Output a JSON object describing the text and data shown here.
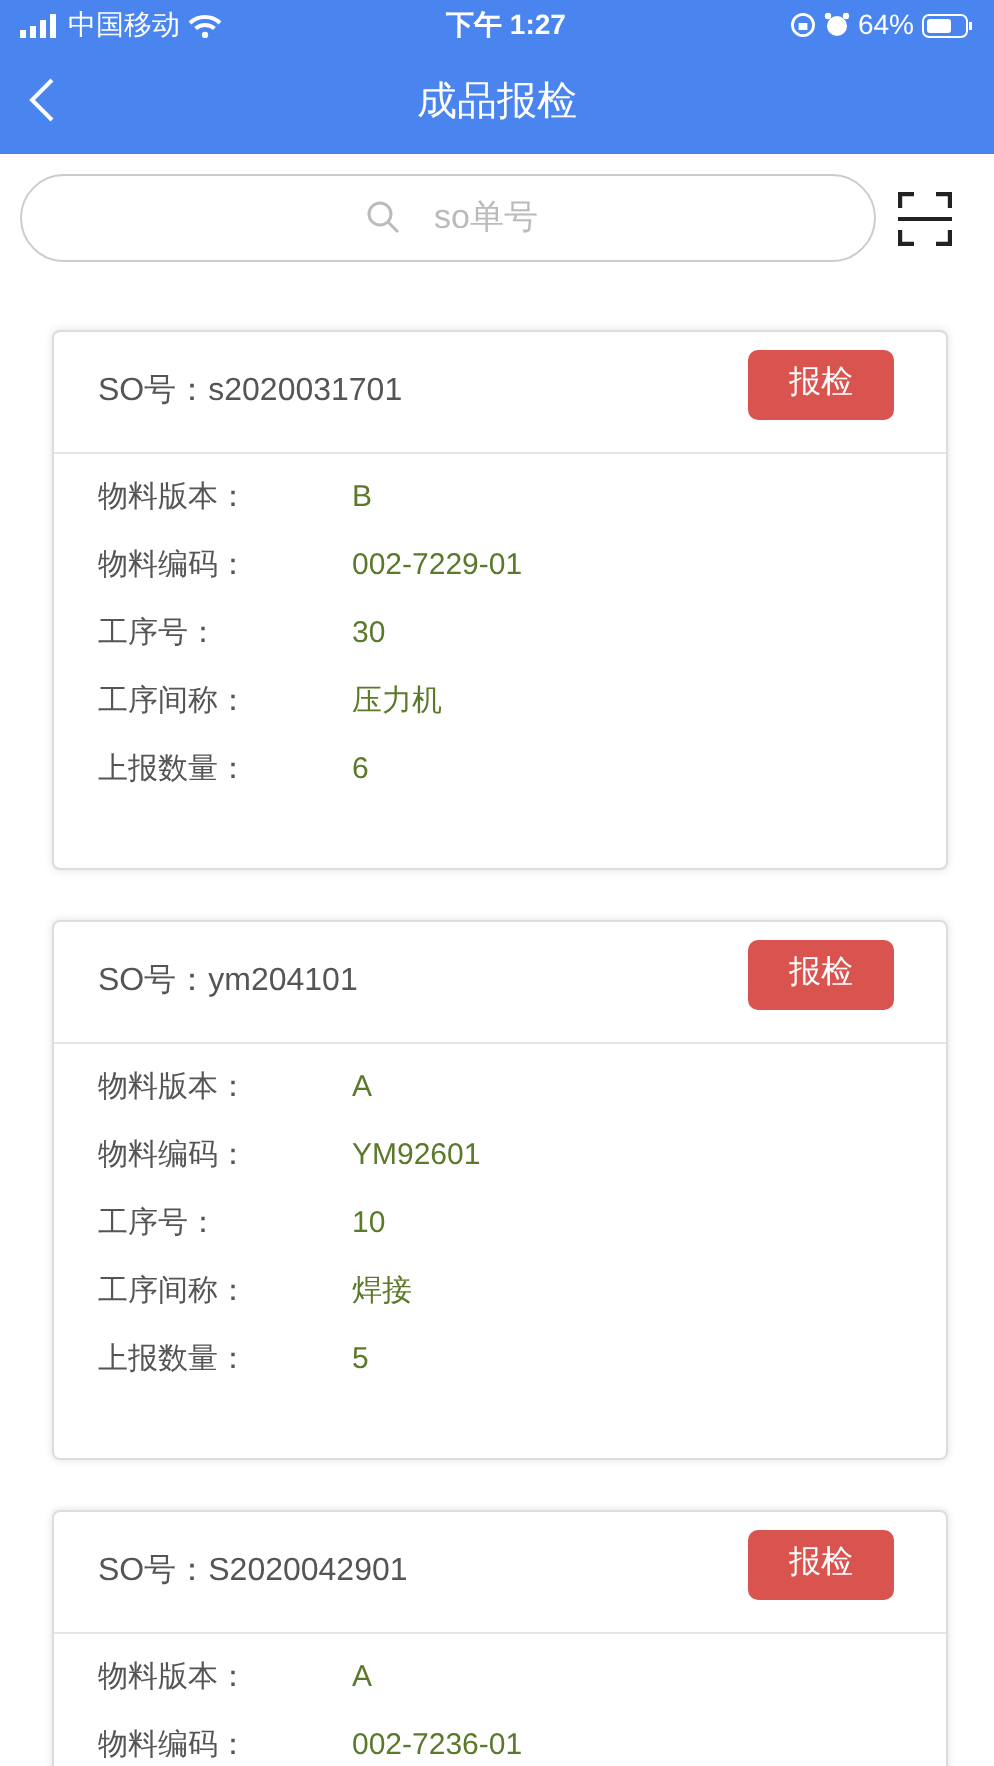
{
  "status_bar": {
    "carrier": "中国移动",
    "time": "下午 1:27",
    "battery": "64%"
  },
  "navbar": {
    "title": "成品报检"
  },
  "search": {
    "placeholder": "so单号"
  },
  "orders": [
    {
      "so": "SO号：s2020031701",
      "button": "报检",
      "fields": [
        {
          "label": "物料版本：",
          "value": "B"
        },
        {
          "label": "物料编码：",
          "value": "002-7229-01"
        },
        {
          "label": "工序号：",
          "value": "30"
        },
        {
          "label": "工序间称：",
          "value": "压力机"
        },
        {
          "label": "上报数量：",
          "value": "6"
        }
      ]
    },
    {
      "so": "SO号：ym204101",
      "button": "报检",
      "fields": [
        {
          "label": "物料版本：",
          "value": "A"
        },
        {
          "label": "物料编码：",
          "value": "YM92601"
        },
        {
          "label": "工序号：",
          "value": "10"
        },
        {
          "label": "工序间称：",
          "value": "焊接"
        },
        {
          "label": "上报数量：",
          "value": "5"
        }
      ]
    },
    {
      "so": "SO号：S2020042901",
      "button": "报检",
      "fields": [
        {
          "label": "物料版本：",
          "value": "A"
        },
        {
          "label": "物料编码：",
          "value": "002-7236-01"
        }
      ]
    }
  ]
}
